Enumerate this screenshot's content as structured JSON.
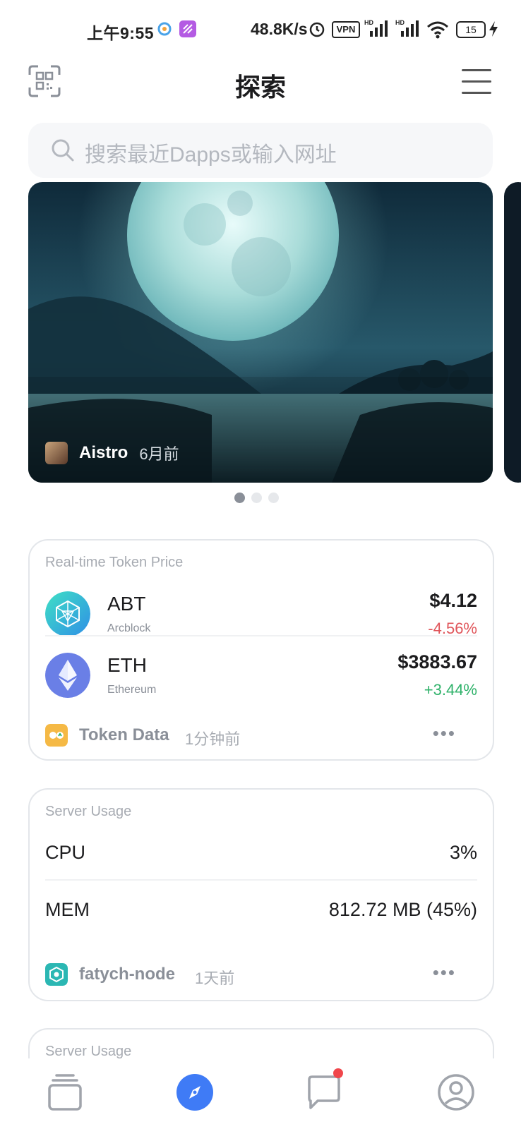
{
  "status_bar": {
    "time": "上午9:55",
    "network_speed": "48.8K/s",
    "vpn": "VPN",
    "battery": "15"
  },
  "header": {
    "title": "探索"
  },
  "search": {
    "placeholder": "搜索最近Dapps或输入网址"
  },
  "banner": {
    "author": "Aistro",
    "time_ago": "6月前",
    "pages": 3,
    "active_page": 1
  },
  "token_card": {
    "title": "Real-time Token Price",
    "tokens": [
      {
        "symbol": "ABT",
        "name": "Arcblock",
        "price": "$4.12",
        "change": "-4.56%",
        "change_color": "#e0565b"
      },
      {
        "symbol": "ETH",
        "name": "Ethereum",
        "price": "$3883.67",
        "change": "+3.44%",
        "change_color": "#2fb26a"
      }
    ],
    "source": "Token Data",
    "time_ago": "1分钟前"
  },
  "server_card": {
    "title": "Server Usage",
    "rows": [
      {
        "label": "CPU",
        "value": "3%"
      },
      {
        "label": "MEM",
        "value": "812.72 MB (45%)"
      }
    ],
    "source": "fatych-node",
    "time_ago": "1天前"
  },
  "server_card_2": {
    "title": "Server Usage"
  },
  "nav": {
    "items": [
      "dapps-icon",
      "explore-icon",
      "messages-icon",
      "profile-icon"
    ],
    "active": "explore-icon",
    "accent": "#3f7bf6"
  }
}
